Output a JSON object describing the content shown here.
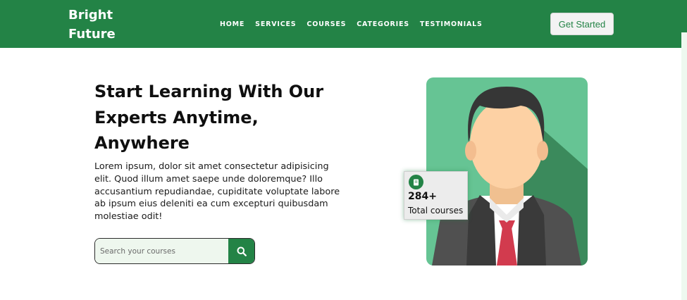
{
  "brand": {
    "name": "Bright\nFuture"
  },
  "nav": {
    "links": [
      "HOME",
      "SERVICES",
      "COURSES",
      "CATEGORIES",
      "TESTIMONIALS"
    ],
    "cta_label": "Get Started"
  },
  "hero": {
    "title": "Start Learning With Our Experts Anytime, Anywhere",
    "description": "Lorem ipsum, dolor sit amet consectetur adipisicing elit. Quod illum amet saepe unde doloremque? Illo accusantium repudiandae, cupiditate voluptate labore ab ipsum eius deleniti ea cum excepturi quibusdam molestiae odit!",
    "search": {
      "placeholder": "Search your courses",
      "value": ""
    }
  },
  "stats": {
    "number": "284+",
    "label": "Total courses",
    "icon": "book-icon"
  },
  "icons": {
    "search": "search-icon",
    "avatar": "person-avatar-icon"
  },
  "colors": {
    "brand_green": "#238346",
    "light_green": "#eef7ee",
    "portrait_bg": "#66c494"
  }
}
